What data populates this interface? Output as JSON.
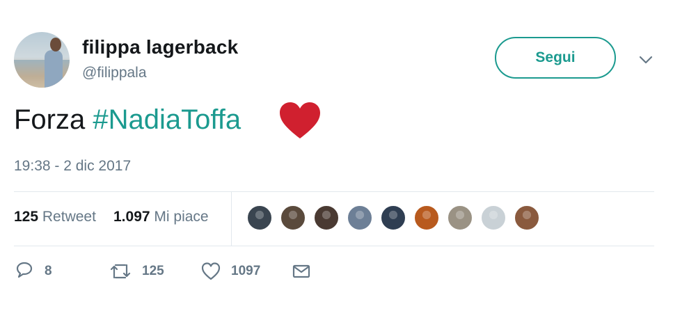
{
  "user": {
    "name": "filippa lagerback",
    "handle": "@filippala"
  },
  "follow_label": "Segui",
  "tweet": {
    "text_plain": "Forza",
    "hashtag": "#NadiaToffa",
    "emoji": "red-heart-emoji",
    "timestamp": "19:38 - 2 dic 2017"
  },
  "stats": {
    "retweets_count": "125",
    "retweets_label": "Retweet",
    "likes_count": "1.097",
    "likes_label": "Mi piace"
  },
  "likers": [
    {
      "name": "liker-avatar-1",
      "color": "#3a4550"
    },
    {
      "name": "liker-avatar-2",
      "color": "#5a4a3c"
    },
    {
      "name": "liker-avatar-3",
      "color": "#4a3a32"
    },
    {
      "name": "liker-avatar-4",
      "color": "#6d7f96"
    },
    {
      "name": "liker-avatar-5",
      "color": "#2f3e52"
    },
    {
      "name": "liker-avatar-6",
      "color": "#b85a1e"
    },
    {
      "name": "liker-avatar-7",
      "color": "#9a9284"
    },
    {
      "name": "liker-avatar-8",
      "color": "#c9d1d6"
    },
    {
      "name": "liker-avatar-9",
      "color": "#8a5a3e"
    }
  ],
  "actions": {
    "reply_count": "8",
    "retweet_count": "125",
    "like_count": "1097"
  },
  "colors": {
    "accent": "#1b9a8f",
    "secondary_text": "#657786",
    "heart": "#d0202f"
  }
}
